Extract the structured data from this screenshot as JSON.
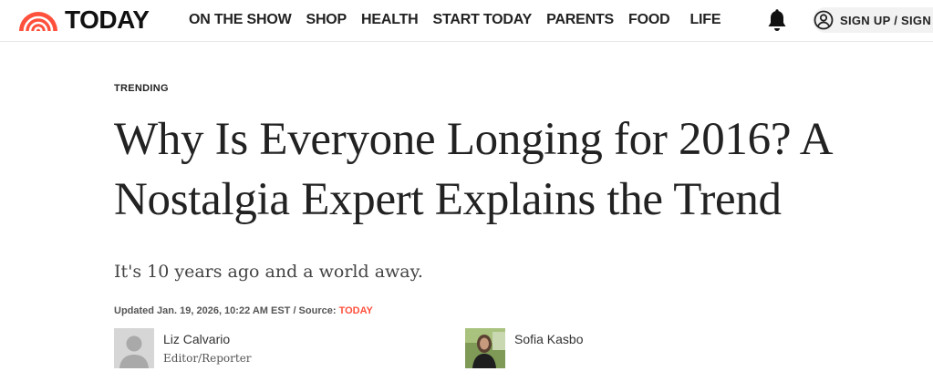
{
  "header": {
    "logo_text": "TODAY",
    "nav": [
      "ON THE SHOW",
      "SHOP",
      "HEALTH",
      "START TODAY",
      "PARENTS",
      "FOOD",
      "LIFE"
    ],
    "signin_label": "SIGN UP / SIGN I",
    "colors": {
      "logo_orange": "#ff503c",
      "nav_text": "#222222"
    },
    "icons": [
      "today-sunrise-logo-icon",
      "bell-icon",
      "user-circle-icon"
    ]
  },
  "article": {
    "kicker": "TRENDING",
    "headline": "Why Is Everyone Longing for 2016? A Nostalgia Expert Explains the Trend",
    "dek": "It's 10 years ago and a world away.",
    "meta_prefix": "Updated Jan. 19, 2026, 10:22 AM EST / Source: ",
    "meta_source": "TODAY",
    "authors": [
      {
        "name": "Liz Calvario",
        "role": "Editor/Reporter"
      },
      {
        "name": "Sofia Kasbo",
        "role": ""
      }
    ]
  }
}
